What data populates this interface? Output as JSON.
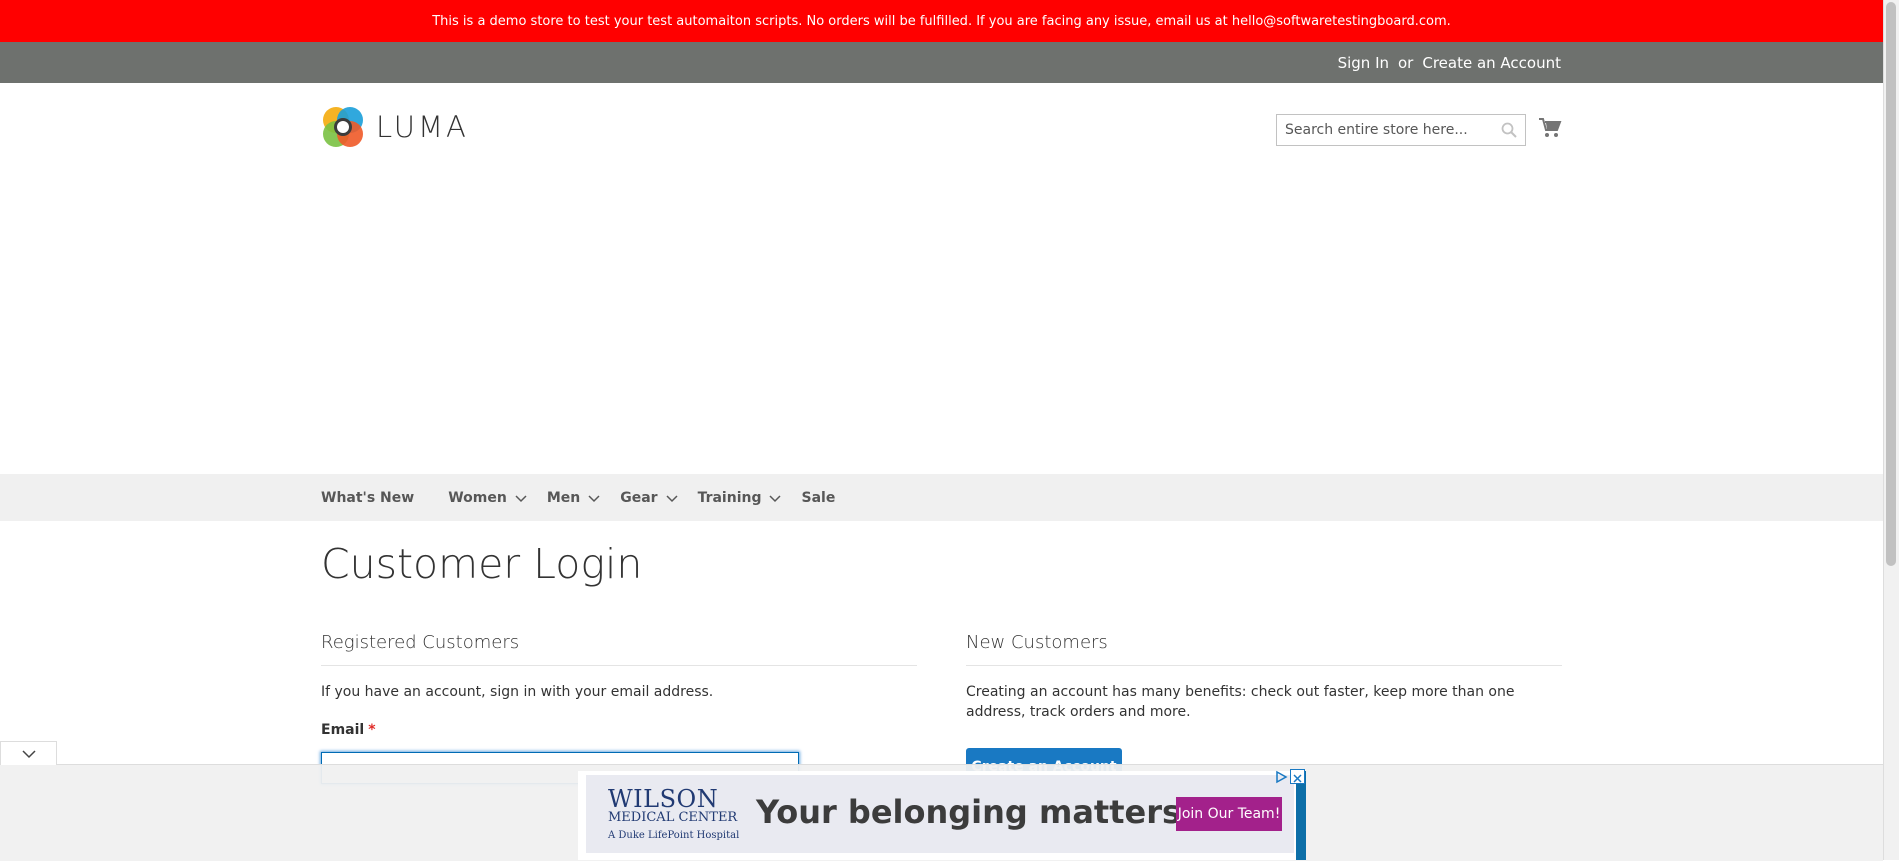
{
  "demo_banner": {
    "text": "This is a demo store to test your test automaiton scripts. No orders will be fulfilled. If you are facing any issue, email us at hello@softwaretestingboard.com."
  },
  "header_links": {
    "sign_in": "Sign In",
    "or": "or",
    "create_account": "Create an Account"
  },
  "logo": {
    "text": "LUMA"
  },
  "search": {
    "placeholder": "Search entire store here..."
  },
  "nav": {
    "items": [
      {
        "label": "What's New",
        "has_submenu": false
      },
      {
        "label": "Women",
        "has_submenu": true
      },
      {
        "label": "Men",
        "has_submenu": true
      },
      {
        "label": "Gear",
        "has_submenu": true
      },
      {
        "label": "Training",
        "has_submenu": true
      },
      {
        "label": "Sale",
        "has_submenu": false
      }
    ]
  },
  "page": {
    "title": "Customer Login"
  },
  "registered": {
    "title": "Registered Customers",
    "intro": "If you have an account, sign in with your email address.",
    "email_label": "Email",
    "required_mark": "*",
    "email_value": ""
  },
  "new_customers": {
    "title": "New Customers",
    "intro": "Creating an account has many benefits: check out faster, keep more than one address, track orders and more.",
    "button": "Create an Account"
  },
  "ad": {
    "brand_line1": "WILSON",
    "brand_line2": "MEDICAL CENTER",
    "brand_line3": "A Duke LifePoint Hospital",
    "headline": "Your belonging matters.",
    "cta": "Join Our Team!"
  },
  "colors": {
    "banner": "#ff0000",
    "top_bar": "#6e716e",
    "nav_bg": "#f0f0f0",
    "primary": "#1979c3",
    "ad_cta": "#a3218b"
  }
}
